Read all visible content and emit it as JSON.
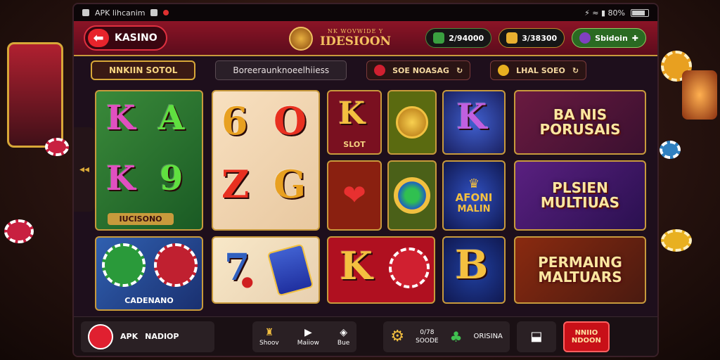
{
  "status_bar": {
    "app_label": "APK lihcanim",
    "indicators": "⚡ ≈ ▮ 80%"
  },
  "header": {
    "back_label": "KASINO",
    "logo_small": "NK WOVWIDE Y",
    "logo_big": "IDESIOON",
    "balance_green": "2/94000",
    "balance_gold": "3/38300",
    "shop_label": "Sbidoin"
  },
  "subbar": {
    "active_tab": "NNKIIN SOTOL",
    "search_text": "Boreeraunknoeelhiiess",
    "filter_left": "SOE NOASAG",
    "filter_right": "LHAL SOEO"
  },
  "tiles": {
    "t1_caption": "IUCISONO",
    "t3_caption": "SLOT",
    "t4_caption": "CADENANO",
    "t_afoni_1": "AFONI",
    "t_afoni_2": "MALIN"
  },
  "banners": {
    "b1_line1": "BA NIS",
    "b1_line2": "PORUSAIS",
    "b2_line1": "PLSIEN",
    "b2_line2": "MULTIUAS",
    "b3_line1": "PERMAING",
    "b3_line2": "MALTUARS"
  },
  "bottom": {
    "apk": "APK",
    "nadiop": "NADIOP",
    "shoo": "Shoov",
    "maiiow": "Maiiow",
    "bue": "Bue",
    "stats_1": "0/78",
    "stats_2": "SOODE",
    "orisina": "ORISINA",
    "cta": "NNIIO NDOON"
  },
  "colors": {
    "accent_gold": "#c89a3c",
    "header_red": "#8c1426",
    "cta_red": "#c81018"
  }
}
